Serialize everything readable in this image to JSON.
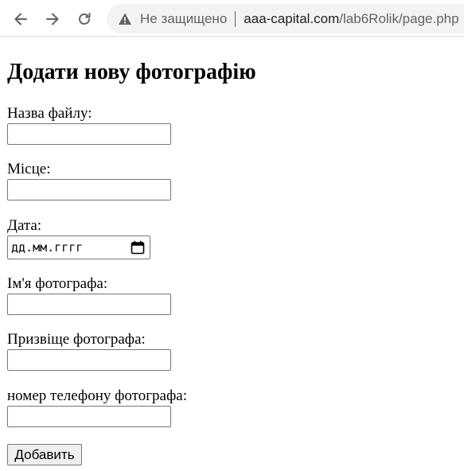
{
  "browser": {
    "back_icon": "back-arrow-icon",
    "forward_icon": "forward-arrow-icon",
    "reload_icon": "reload-icon",
    "security_icon": "warning-triangle-icon",
    "security_text": "Не защищено",
    "url_host": "aaa-capital.com",
    "url_path": "/lab6Rolik/page.php"
  },
  "form": {
    "title": "Додати нову фотографію",
    "fields": [
      {
        "label": "Назва файлу:",
        "value": ""
      },
      {
        "label": "Місце:",
        "value": ""
      },
      {
        "label": "Дата:",
        "placeholder": "дд.мм.гггг"
      },
      {
        "label": "Ім'я фотографа:",
        "value": ""
      },
      {
        "label": "Призвіще фотографа:",
        "value": ""
      },
      {
        "label": "номер телефону фотографа:",
        "value": ""
      }
    ],
    "submit_label": "Добавить"
  }
}
